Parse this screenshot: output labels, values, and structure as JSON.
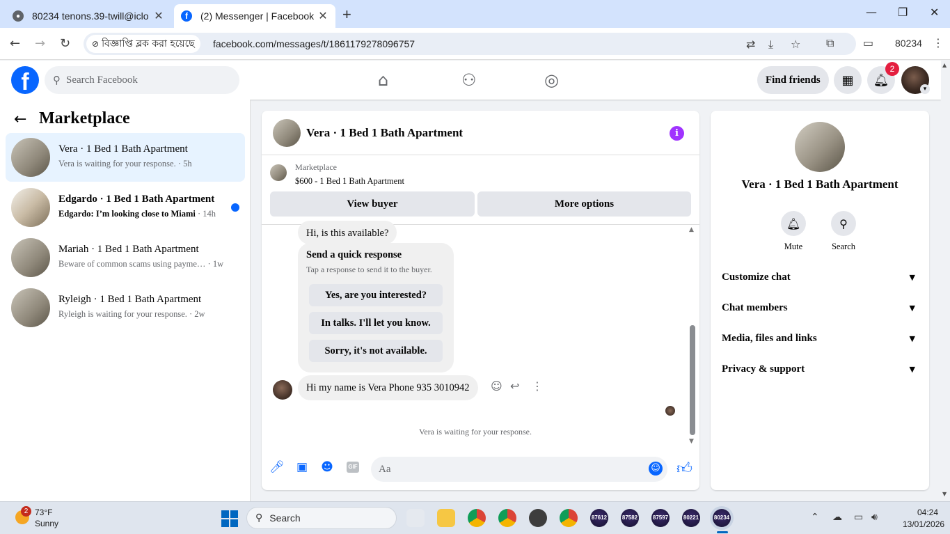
{
  "browser": {
    "tabs": [
      {
        "title": "80234 tenons.39-twill@iclo",
        "active": false
      },
      {
        "title": "(2) Messenger | Facebook",
        "active": true
      }
    ],
    "new_tab": "+",
    "window_controls": {
      "minimize": "—",
      "maximize": "❐",
      "close": "✕"
    },
    "ads_blocked_label": "বিজ্ঞাপ্তি ব্লক করা হয়েছে",
    "url": "facebook.com/messages/t/1861179278096757",
    "profile_label": "80234"
  },
  "facebook": {
    "search_placeholder": "Search Facebook",
    "find_friends_label": "Find friends",
    "notification_count": "2"
  },
  "sidebar": {
    "title": "Marketplace",
    "conversations": [
      {
        "name": "Vera · 1 Bed 1 Bath Apartment",
        "snippet": "Vera is waiting for your response.",
        "time": " · 5h",
        "selected": true,
        "unread": false
      },
      {
        "name": "Edgardo · 1 Bed 1 Bath Apartment",
        "snippet": "Edgardo: I’m looking close to Miami",
        "time": " · 14h",
        "selected": false,
        "unread": true
      },
      {
        "name": "Mariah · 1 Bed 1 Bath Apartment",
        "snippet": "Beware of common scams using payme…",
        "time": " · 1w",
        "selected": false,
        "unread": false
      },
      {
        "name": "Ryleigh · 1 Bed 1 Bath Apartment",
        "snippet": "Ryleigh is waiting for your response.",
        "time": " · 2w",
        "selected": false,
        "unread": false
      }
    ]
  },
  "chat": {
    "title": "Vera · 1 Bed 1 Bath Apartment",
    "listing": {
      "category": "Marketplace",
      "price_title": "$600 - 1 Bed 1 Bath Apartment",
      "view_buyer_label": "View buyer",
      "more_options_label": "More options"
    },
    "messages": {
      "first_message": "Hi, is this available?",
      "quick_response": {
        "title": "Send a quick response",
        "subtitle": "Tap a response to send it to the buyer.",
        "options": [
          "Yes, are you interested?",
          "In talks. I'll let you know.",
          "Sorry, it's not available."
        ]
      },
      "incoming_message": "Hi my name is Vera Phone 935 3010942",
      "waiting_note": "Vera is waiting for your response."
    },
    "composer": {
      "placeholder": "Aa",
      "gif_label": "GIF"
    }
  },
  "info_panel": {
    "name": "Vera · 1 Bed 1 Bath Apartment",
    "actions": [
      {
        "label": "Mute",
        "icon": "bell-icon"
      },
      {
        "label": "Search",
        "icon": "search-icon"
      }
    ],
    "sections": [
      "Customize chat",
      "Chat members",
      "Media, files and links",
      "Privacy & support"
    ]
  },
  "taskbar": {
    "weather_badge": "2",
    "temperature": "73°F",
    "condition": "Sunny",
    "search_label": "Search",
    "apps_numbered": [
      "87612",
      "87582",
      "87597",
      "80221",
      "80234"
    ],
    "time": "04:24",
    "date": "13/01/2026"
  },
  "colors": {
    "facebook_blue": "#0866ff",
    "selected_bg": "#e7f3ff",
    "info_purple": "#a033ff",
    "notification_red": "#e41e3f"
  }
}
